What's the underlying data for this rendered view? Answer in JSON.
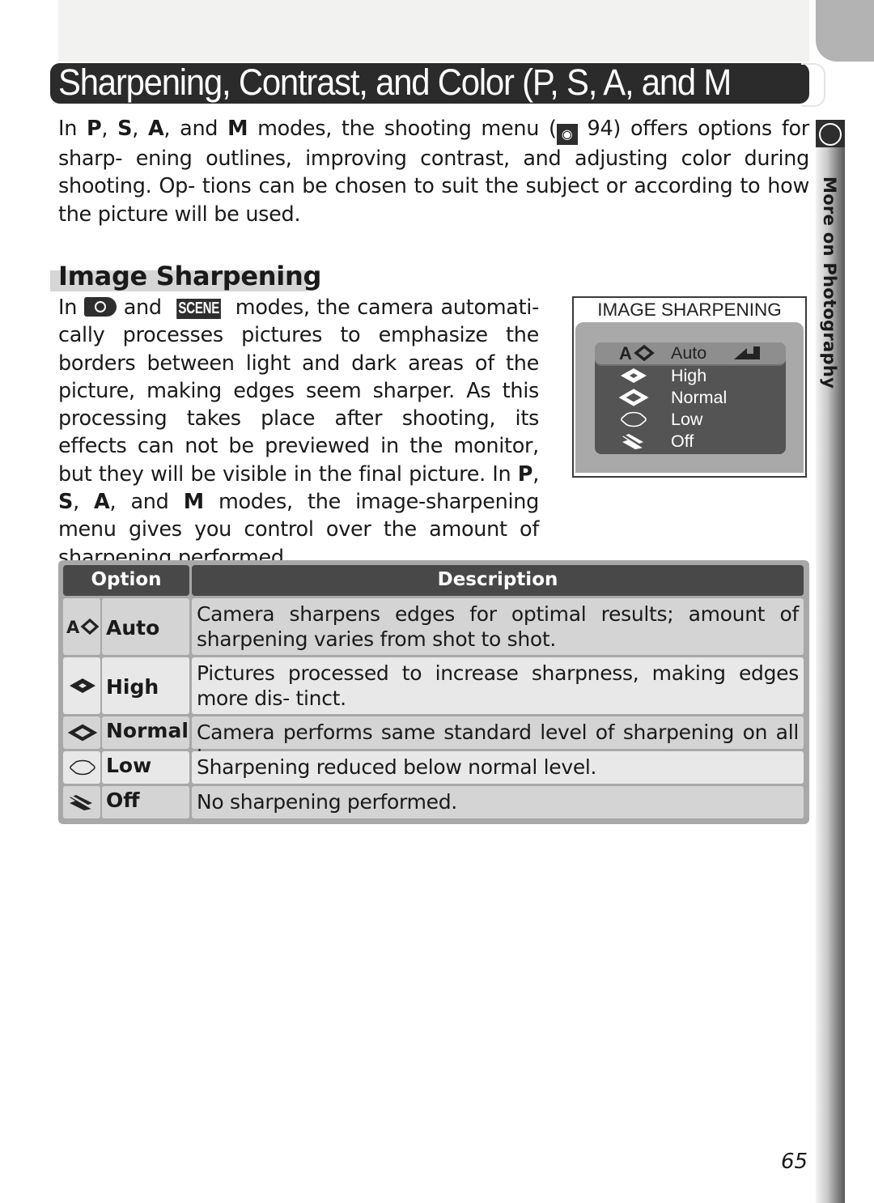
{
  "page": {
    "title": "Sharpening, Contrast, and Color (P, S, A, and M)",
    "title_visible": "Sharpening, Contrast, and Color (P, S, A, and M",
    "side_tab_label": "More on Photography",
    "page_number": "65"
  },
  "intro": {
    "t1": "In ",
    "m1": "P",
    "t2": ", ",
    "m2": "S",
    "t3": ", ",
    "m3": "A",
    "t4": ", and ",
    "m4": "M",
    "t5": " modes, the shooting menu (",
    "ref_icon": "menu-ref-icon",
    "t6": " 94) offers options for sharp- ening outlines, improving contrast, and adjusting color during shooting.  Op- tions can be chosen to suit the subject or according to how the picture will be used."
  },
  "section": {
    "heading": "Image Sharpening",
    "p1": "In ",
    "camera_icon": "auto-mode-camera-icon",
    "p2": " and ",
    "scene_label": "SCENE",
    "p3": " modes, the camera automati- cally processes pictures to emphasize the borders between light and dark areas of the picture, making edges seem sharper.  As this processing takes place after shooting, its effects can not be previewed in the monitor, but they will be visible in the final picture.  In ",
    "m1": "P",
    "p4": ", ",
    "m2": "S",
    "p5": ", ",
    "m3": "A",
    "p6": ", and ",
    "m4": "M",
    "p7": "  modes, the image-sharpening menu gives you control over the amount of sharpening performed."
  },
  "menu_screen": {
    "title": "IMAGE SHARPENING",
    "selected_index": 0,
    "items": [
      {
        "label": "Auto",
        "icon": "sharpening-auto-icon"
      },
      {
        "label": "High",
        "icon": "sharpening-high-icon"
      },
      {
        "label": "Normal",
        "icon": "sharpening-normal-icon"
      },
      {
        "label": "Low",
        "icon": "sharpening-low-icon"
      },
      {
        "label": "Off",
        "icon": "sharpening-off-icon"
      }
    ]
  },
  "table": {
    "headers": [
      "Option",
      "Description"
    ],
    "rows": [
      {
        "option": "Auto",
        "icon": "sharpening-auto-icon",
        "description": "Camera sharpens edges for optimal results; amount of sharpening varies from shot to shot."
      },
      {
        "option": "High",
        "icon": "sharpening-high-icon",
        "description": "Pictures processed to increase sharpness, making edges more dis- tinct."
      },
      {
        "option": "Normal",
        "icon": "sharpening-normal-icon",
        "description": "Camera performs same standard level of sharpening on all images."
      },
      {
        "option": "Low",
        "icon": "sharpening-low-icon",
        "description": "Sharpening reduced below normal level."
      },
      {
        "option": "Off",
        "icon": "sharpening-off-icon",
        "description": "No sharpening performed."
      }
    ]
  },
  "colors": {
    "title_bar": "#2b2b2b",
    "table_header": "#484848",
    "table_row_dark": "#d4d4d4",
    "table_row_light": "#e8e8e8",
    "menu_list": "#545454",
    "menu_panel": "#a9a9a9"
  }
}
